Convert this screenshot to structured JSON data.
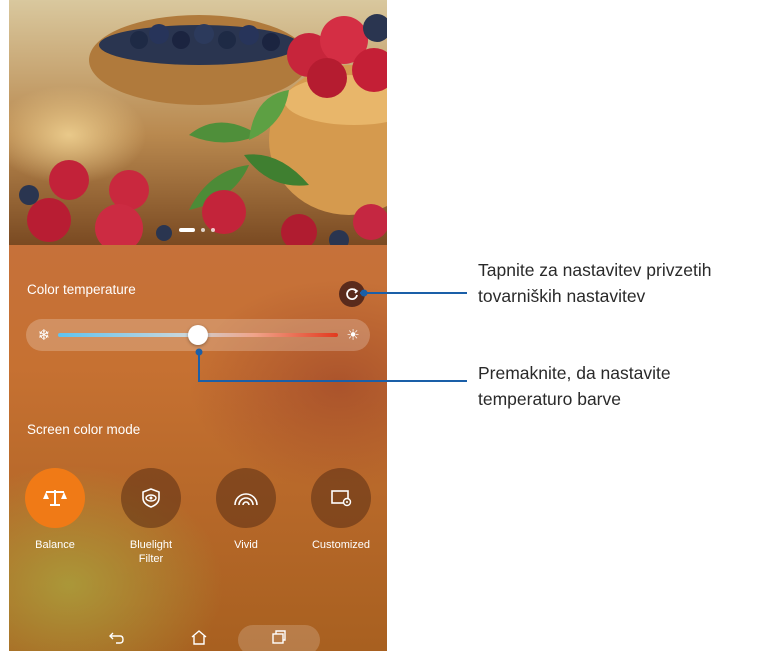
{
  "color_temperature": {
    "label": "Color temperature",
    "slider_value": 0.5,
    "cold_icon": "snowflake-icon",
    "warm_icon": "sun-icon",
    "reset_icon": "reset-icon"
  },
  "screen_color_mode": {
    "label": "Screen color mode",
    "modes": [
      {
        "label": "Balance",
        "icon": "balance-scale-icon",
        "selected": true
      },
      {
        "label": "Bluelight Filter",
        "icon": "eye-shield-icon",
        "selected": false
      },
      {
        "label": "Vivid",
        "icon": "rainbow-icon",
        "selected": false
      },
      {
        "label": "Customized",
        "icon": "screen-settings-icon",
        "selected": false
      }
    ]
  },
  "wallpaper_pages": {
    "count": 3,
    "current": 1
  },
  "navbar": {
    "icons": [
      "back-icon",
      "home-icon",
      "recent-apps-icon"
    ]
  },
  "callouts": {
    "reset": "Tapnite za nastavitev privzetih tovarniških nastavitev",
    "slider": "Premaknite, da nastavite temperaturo barve"
  },
  "colors": {
    "accent": "#f07a16",
    "callout_line": "#1a5fa8"
  }
}
